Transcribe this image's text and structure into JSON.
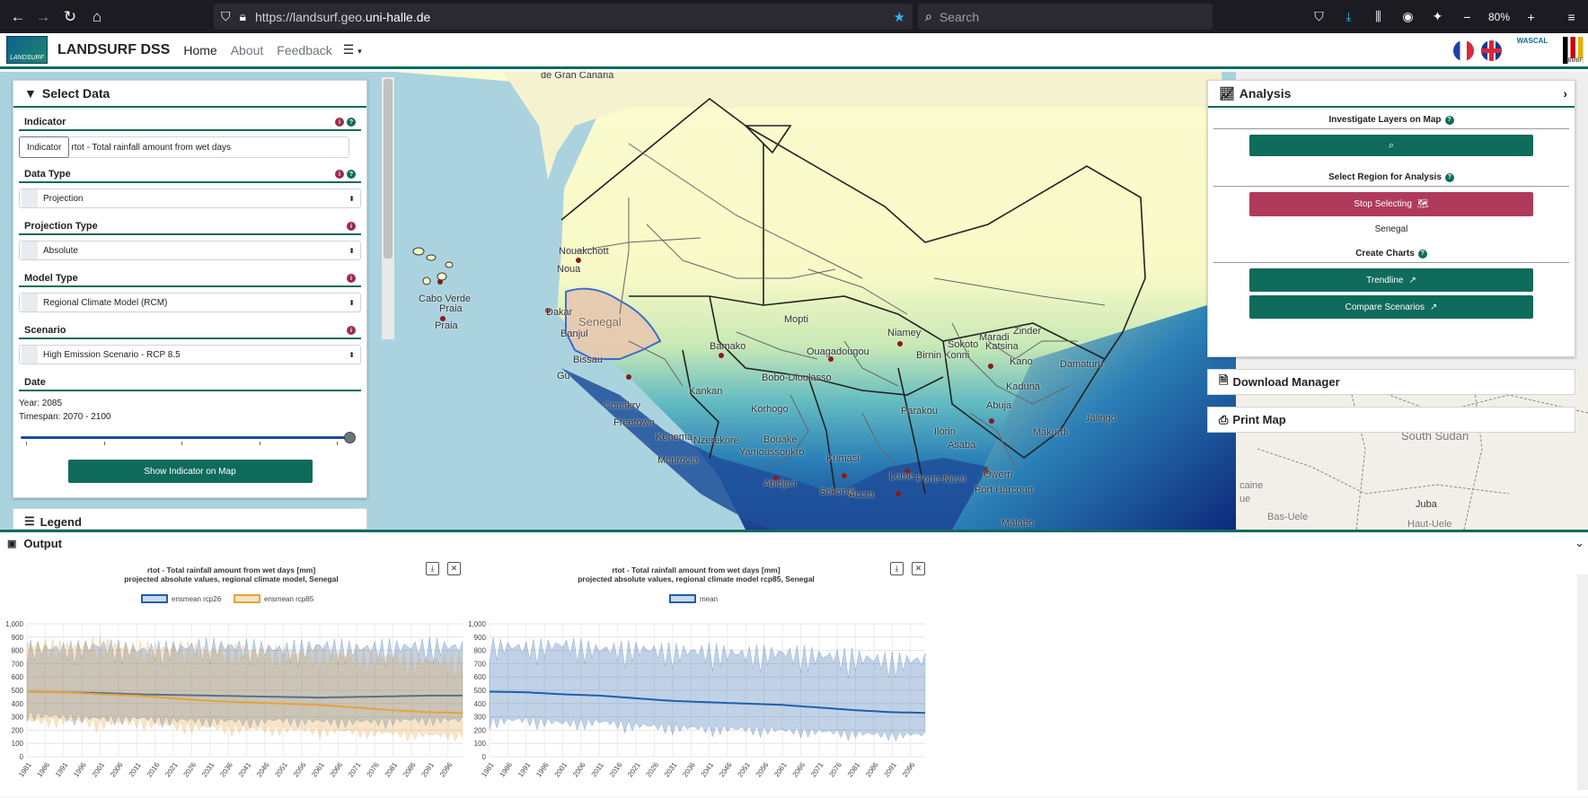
{
  "browser": {
    "url_prefix": "https://landsurf.geo.",
    "url_domain": "uni-halle.de",
    "search_placeholder": "Search",
    "zoom": "80%"
  },
  "header": {
    "logo_text": "LANDSURF",
    "brand": "LANDSURF DSS",
    "nav": [
      "Home",
      "About",
      "Feedback"
    ],
    "partner_logo": "WASCAL",
    "funder_logo": "BMBF"
  },
  "select_data": {
    "title": "Select Data",
    "indicator_label": "Indicator",
    "indicator_button": "Indicator",
    "indicator_value": "rtot - Total rainfall amount from wet days",
    "data_type_label": "Data Type",
    "data_type_value": "Projection",
    "projection_type_label": "Projection Type",
    "projection_type_value": "Absolute",
    "model_type_label": "Model Type",
    "model_type_value": "Regional Climate Model (RCM)",
    "scenario_label": "Scenario",
    "scenario_value": "High Emission Scenario - RCP 8.5",
    "date_label": "Date",
    "year_text": "Year: 2085",
    "timespan_text": "Timespan: 2070 - 2100",
    "slider_level": 1.0,
    "show_button": "Show Indicator on Map"
  },
  "legend_title": "Legend",
  "analysis": {
    "title": "Analysis",
    "investigate_label": "Investigate Layers on Map",
    "select_region_label": "Select Region for Analysis",
    "stop_button": "Stop Selecting",
    "region_name": "Senegal",
    "create_charts_label": "Create Charts",
    "trendline_button": "Trendline",
    "compare_button": "Compare Scenarios"
  },
  "download_manager": "Download Manager",
  "print_map": "Print Map",
  "map_labels": {
    "gran_canaria": "de Gran Canaria",
    "nouakchott": "Nouakchott",
    "nouad": "Noua",
    "cabo_verde": "Cabo Verde",
    "praia": "Praia",
    "praia2": "Praia",
    "dakar": "Dakar",
    "banjul": "Banjul",
    "senegal": "Senegal",
    "bissau": "Bissau",
    "gui": "Gu",
    "bamako": "Bamako",
    "mopti": "Mopti",
    "niamey": "Niamey",
    "ouagadougou": "Ouagadougou",
    "zinder": "Zinder",
    "maradi": "Maradi",
    "katsina": "Katsina",
    "sokoto": "Sokoto",
    "birnin_konni": "Birnin Konni",
    "kano": "Kano",
    "damaturu": "Damaturu",
    "bobo": "Bobo-Dioulasso",
    "kankan": "Kankan",
    "conakry": "Conakry",
    "freetown": "Freetown",
    "kenema": "Kenema",
    "nzerekore": "Nzerekore",
    "monrovia": "Monrovia",
    "korhogo": "Korhogo",
    "bouake": "Bouake",
    "yamoussoukro": "Yamoussoukro",
    "abidjan": "Abidjan",
    "sekondi": "Sekondi",
    "accra": "Accra",
    "kumasi": "Kumasi",
    "lome": "Lome",
    "porto_novo": "Porto-Novo",
    "parakou": "Parakou",
    "ilorin": "Ilorin",
    "abuja": "Abuja",
    "kaduna": "Kaduna",
    "jalingo": "Jalingo",
    "makurdi": "Makurdi",
    "owerri": "Owerri",
    "asaba": "Asaba",
    "port_harcourt": "Port Harcourt",
    "malabo": "Malabo",
    "south_sudan": "South Sudan",
    "juba": "Juba",
    "bas_uele": "Bas-Uele",
    "haut_uele": "Haut-Uele",
    "caine": "caine",
    "ue": "ue"
  },
  "output": {
    "title": "Output",
    "chart1_title": "rtot - Total rainfall amount from wet days [mm]",
    "chart1_subtitle": "projected absolute values, regional climate model, Senegal",
    "chart2_title": "rtot - Total rainfall amount from wet days [mm]",
    "chart2_subtitle": "projected absolute values, regional climate model rcp85, Senegal"
  },
  "colors": {
    "primary": "#0f6b5c",
    "rose": "#b03a5b",
    "rcp26": "#1f5fa8",
    "rcp85": "#e6a23c"
  },
  "chart_data": [
    {
      "type": "area",
      "title": "rtot - Total rainfall amount from wet days [mm]",
      "subtitle": "projected absolute values, regional climate model, Senegal",
      "ylim": [
        0,
        1000
      ],
      "yticks": [
        "0",
        "100",
        "200",
        "300",
        "400",
        "500",
        "600",
        "700",
        "800",
        "900",
        "1,000"
      ],
      "xticks": [
        "1981",
        "1986",
        "1991",
        "1996",
        "2001",
        "2006",
        "2011",
        "2016",
        "2021",
        "2026",
        "2031",
        "2036",
        "2041",
        "2046",
        "2051",
        "2056",
        "2061",
        "2066",
        "2071",
        "2076",
        "2081",
        "2086",
        "2091",
        "2096"
      ],
      "grid": true,
      "legend_position": "top-center",
      "series": [
        {
          "name": "ensmean rcp26",
          "color": "#1f5fa8",
          "x": [
            1981,
            1991,
            2001,
            2011,
            2021,
            2031,
            2041,
            2051,
            2061,
            2071,
            2081,
            2091,
            2100
          ],
          "mean": [
            490,
            485,
            480,
            470,
            465,
            460,
            455,
            450,
            445,
            450,
            455,
            460,
            460
          ],
          "upper": [
            880,
            870,
            900,
            860,
            880,
            900,
            890,
            870,
            900,
            880,
            890,
            900,
            890
          ],
          "lower": [
            200,
            180,
            160,
            170,
            150,
            150,
            140,
            160,
            150,
            140,
            150,
            160,
            150
          ]
        },
        {
          "name": "ensmean rcp85",
          "color": "#e6a23c",
          "x": [
            1981,
            1991,
            2001,
            2011,
            2021,
            2031,
            2041,
            2051,
            2061,
            2071,
            2081,
            2091,
            2100
          ],
          "mean": [
            490,
            485,
            470,
            460,
            440,
            420,
            410,
            400,
            390,
            370,
            350,
            335,
            330
          ],
          "upper": [
            900,
            880,
            910,
            870,
            880,
            860,
            860,
            840,
            850,
            830,
            820,
            790,
            800
          ],
          "lower": [
            120,
            140,
            110,
            130,
            100,
            90,
            80,
            80,
            70,
            70,
            60,
            50,
            60
          ]
        }
      ]
    },
    {
      "type": "area",
      "title": "rtot - Total rainfall amount from wet days [mm]",
      "subtitle": "projected absolute values, regional climate model rcp85, Senegal",
      "ylim": [
        0,
        1000
      ],
      "yticks": [
        "0",
        "100",
        "200",
        "300",
        "400",
        "500",
        "600",
        "700",
        "800",
        "900",
        "1,000"
      ],
      "xticks": [
        "1981",
        "1986",
        "1991",
        "1996",
        "2001",
        "2006",
        "2011",
        "2016",
        "2021",
        "2026",
        "2031",
        "2036",
        "2041",
        "2046",
        "2051",
        "2056",
        "2061",
        "2066",
        "2071",
        "2076",
        "2081",
        "2086",
        "2091",
        "2096"
      ],
      "grid": true,
      "legend_position": "top-center",
      "series": [
        {
          "name": "mean",
          "color": "#1f5fa8",
          "x": [
            1981,
            1991,
            2001,
            2011,
            2021,
            2031,
            2041,
            2051,
            2061,
            2071,
            2081,
            2091,
            2100
          ],
          "mean": [
            490,
            485,
            470,
            460,
            440,
            420,
            410,
            400,
            390,
            370,
            350,
            335,
            330
          ],
          "upper": [
            900,
            880,
            910,
            870,
            880,
            860,
            860,
            840,
            850,
            830,
            820,
            790,
            800
          ],
          "lower": [
            120,
            140,
            110,
            130,
            100,
            90,
            80,
            80,
            70,
            70,
            60,
            50,
            60
          ]
        }
      ]
    }
  ]
}
